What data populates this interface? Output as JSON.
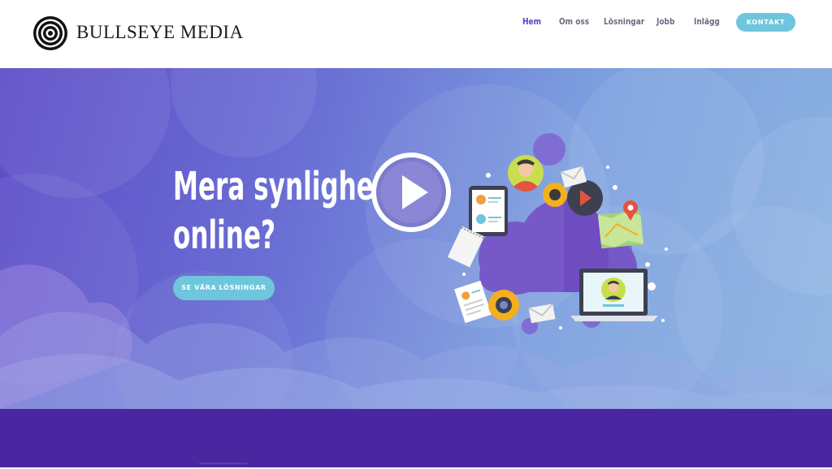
{
  "brand": {
    "name": "BULLSEYE MEDIA",
    "logo_icon": "bullseye-icon"
  },
  "nav": {
    "items": [
      {
        "label": "Hem",
        "active": true
      },
      {
        "label": "Om oss",
        "active": false
      },
      {
        "label": "Lösningar",
        "active": false
      },
      {
        "label": "Jobb",
        "active": false
      },
      {
        "label": "Inlägg",
        "active": false
      }
    ],
    "contact_label": "KONTAKT"
  },
  "hero": {
    "title_line1": "Mera synlighet",
    "title_line2": "online?",
    "cta_label": "SE VÅRA LÖSNINGAR",
    "play_icon": "play-icon"
  },
  "colors": {
    "accent": "#6fc5dc",
    "nav_active": "#5b3fc4",
    "band": "#4a27a0",
    "hero_start": "#5d4cc8",
    "hero_end": "#8db4e2"
  }
}
